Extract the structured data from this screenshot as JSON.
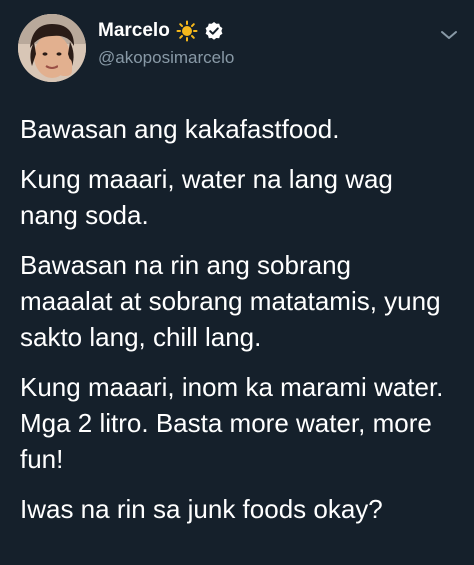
{
  "user": {
    "display_name": "Marcelo",
    "handle": "@akoposimarcelo",
    "emoji_icon": "sun-icon",
    "verified_icon": "verified-badge-icon"
  },
  "tweet": {
    "paragraphs": [
      {
        "lines": [
          "Bawasan ang kakafastfood."
        ]
      },
      {
        "lines": [
          "Kung maaari, water na lang wag",
          "nang soda."
        ]
      },
      {
        "lines": [
          "Bawasan na rin ang sobrang",
          "maaalat at sobrang matatamis, yung",
          "sakto lang, chill lang."
        ]
      },
      {
        "lines": [
          "Kung maaari, inom ka marami water.",
          "Mga 2 litro. Basta more water, more",
          "fun!"
        ]
      },
      {
        "lines": [
          "Iwas na rin sa junk foods okay?"
        ]
      }
    ]
  },
  "colors": {
    "background": "#15202b",
    "text": "#ffffff",
    "handle": "#8899a6",
    "sun": "#f5b81c"
  }
}
